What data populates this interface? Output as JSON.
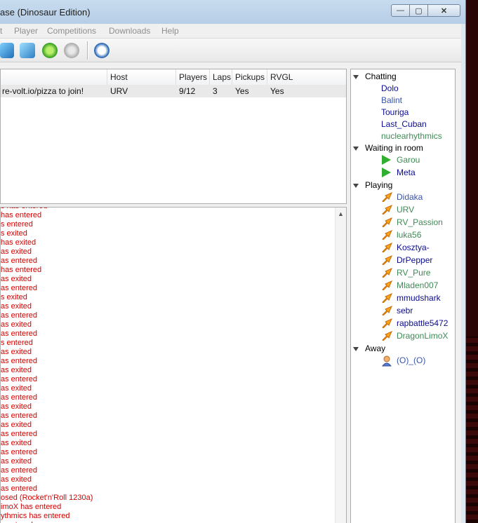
{
  "window": {
    "title": "ase (Dinosaur Edition)",
    "buttons": {
      "minimize": "—",
      "maximize": "▢",
      "close": "✕"
    }
  },
  "menu": [
    "t",
    "Player",
    "Competitions",
    "Downloads",
    "Help"
  ],
  "toolbar": {
    "icons": [
      "server-icon",
      "server-tree-icon",
      "refresh-icon",
      "disconnect-icon",
      "speedometer-icon"
    ]
  },
  "games": {
    "columns": {
      "name": "",
      "host": "Host",
      "players": "Players",
      "laps": "Laps",
      "pickups": "Pickups",
      "rvgl": "RVGL"
    },
    "rows": [
      {
        "name": "re-volt.io/pizza to join!",
        "host": "URV",
        "players": "9/12",
        "laps": "3",
        "pickups": "Yes",
        "rvgl": "Yes"
      }
    ]
  },
  "log": [
    "s has entered",
    "has entered",
    "s entered",
    "s exited",
    "has exited",
    "as exited",
    "as entered",
    "has entered",
    "as exited",
    "as entered",
    "s exited",
    "as exited",
    "as entered",
    "as exited",
    "as entered",
    "s entered",
    "as exited",
    "as entered",
    "as exited",
    "as entered",
    "as exited",
    "as entered",
    "as exited",
    "as entered",
    "as exited",
    "as entered",
    "as exited",
    "as entered",
    "as exited",
    "as entered",
    "as exited",
    "as entered",
    "osed (Rocket'n'Roll 1230a)",
    "imoX has entered",
    "ythmics has entered",
    "s entered"
  ],
  "users": {
    "groups": [
      {
        "label": "Chatting",
        "users": [
          {
            "name": "Dolo",
            "color": "#0b0b8f",
            "icon": null
          },
          {
            "name": "Balint",
            "color": "#3a55a8",
            "icon": null
          },
          {
            "name": "Touriga",
            "color": "#0b0b8f",
            "icon": null
          },
          {
            "name": "Last_Cuban",
            "color": "#0b0b8f",
            "icon": null
          },
          {
            "name": "nuclearhythmics",
            "color": "#3f8a56",
            "icon": null
          }
        ]
      },
      {
        "label": "Waiting in room",
        "users": [
          {
            "name": "Garou",
            "color": "#3f8a56",
            "icon": "play-icon"
          },
          {
            "name": "Meta",
            "color": "#0b0b8f",
            "icon": "play-icon"
          }
        ]
      },
      {
        "label": "Playing",
        "users": [
          {
            "name": "Didaka",
            "color": "#3a55a8",
            "icon": "racing-icon"
          },
          {
            "name": "URV",
            "color": "#3f8a56",
            "icon": "racing-icon"
          },
          {
            "name": "RV_Passion",
            "color": "#3f8a56",
            "icon": "racing-icon"
          },
          {
            "name": "luka56",
            "color": "#3f8a56",
            "icon": "racing-icon"
          },
          {
            "name": "Kosztya-",
            "color": "#0b0b8f",
            "icon": "racing-icon"
          },
          {
            "name": "DrPepper",
            "color": "#0b0b8f",
            "icon": "racing-icon"
          },
          {
            "name": "RV_Pure",
            "color": "#3f8a56",
            "icon": "racing-icon"
          },
          {
            "name": "Mladen007",
            "color": "#3f8a56",
            "icon": "racing-icon"
          },
          {
            "name": "mmudshark",
            "color": "#0b0b8f",
            "icon": "racing-icon"
          },
          {
            "name": "sebr",
            "color": "#0b0b8f",
            "icon": "racing-icon"
          },
          {
            "name": "rapbattle5472",
            "color": "#0b0b8f",
            "icon": "racing-icon"
          },
          {
            "name": "DragonLimoX",
            "color": "#3f8a56",
            "icon": "racing-icon"
          }
        ]
      },
      {
        "label": "Away",
        "users": [
          {
            "name": "(O)_(O)",
            "color": "#3a55a8",
            "icon": "away-user-icon"
          }
        ]
      }
    ]
  }
}
